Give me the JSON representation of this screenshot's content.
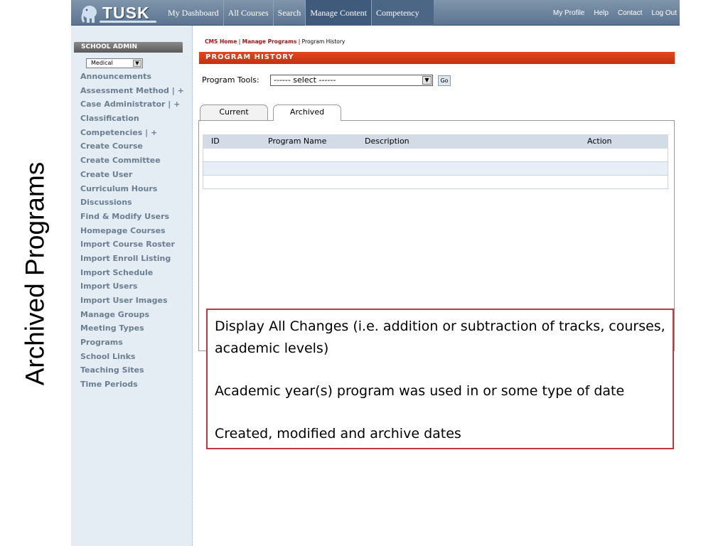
{
  "slide": {
    "title": "Archived Programs"
  },
  "topbar": {
    "logo_text": "TUSK",
    "nav": [
      "My Dashboard",
      "All Courses",
      "Search",
      "Manage Content",
      "Competency"
    ],
    "util": [
      "My Profile",
      "Help",
      "Contact",
      "Log Out"
    ]
  },
  "sidebar": {
    "header": "SCHOOL ADMIN",
    "school_selected": "Medical",
    "items": [
      "Announcements",
      "Assessment Method  | +",
      "Case Administrator | +",
      "Classification",
      "Competencies  | +",
      "Create Course",
      "Create Committee",
      "Create User",
      "Curriculum Hours",
      "Discussions",
      "Find & Modify Users",
      "Homepage Courses",
      "Import Course Roster",
      "Import Enroll Listing",
      "Import Schedule",
      "Import Users",
      "Import User Images",
      "Manage Groups",
      "Meeting Types",
      "Programs",
      "School Links",
      "Teaching Sites",
      "Time Periods"
    ]
  },
  "main": {
    "breadcrumb": {
      "home": "CMS Home",
      "sep": " | ",
      "manage": "Manage Programs",
      "current": "Program History"
    },
    "page_title": "PROGRAM HISTORY",
    "tools_label": "Program Tools:",
    "tools_select": "------ select ------",
    "go_label": "Go",
    "tabs": [
      "Current",
      "Archived"
    ],
    "table": {
      "columns": [
        "ID",
        "Program Name",
        "Description",
        "Action"
      ]
    }
  },
  "callout": {
    "line1": "Display All Changes (i.e. addition or subtraction of tracks, courses, academic levels)",
    "line2": "Academic year(s) program was used in or some type of date",
    "line3": "Created, modified and archive dates"
  },
  "colors": {
    "topbar": "#5c7490",
    "header_bar": "#c2300d",
    "sidebar_bg": "#e4ecf4",
    "callout_border": "#c0393e"
  }
}
